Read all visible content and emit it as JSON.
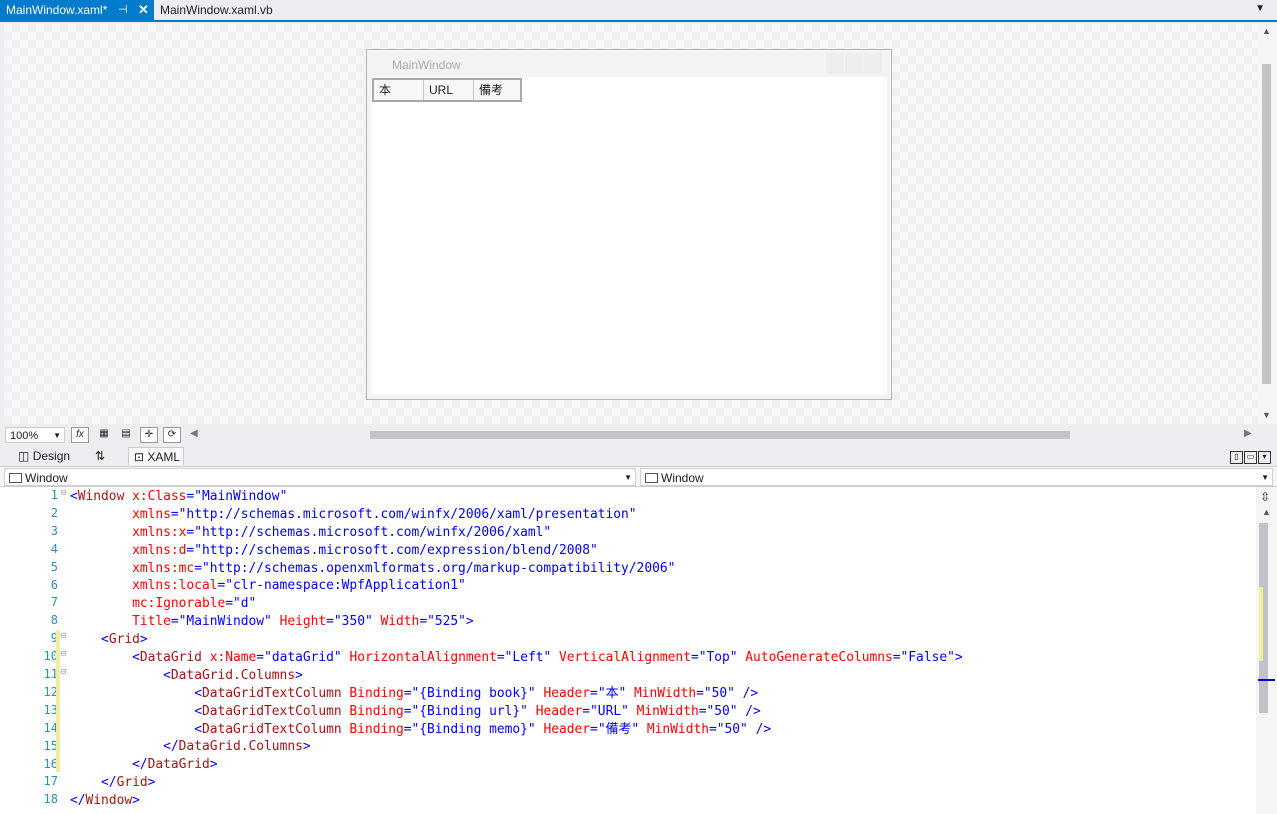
{
  "tabs": [
    {
      "label": "MainWindow.xaml*",
      "active": true
    },
    {
      "label": "MainWindow.xaml.vb",
      "active": false
    }
  ],
  "preview": {
    "window_title": "MainWindow",
    "columns": [
      "本",
      "URL",
      "備考"
    ]
  },
  "zoom": {
    "value": "100%"
  },
  "view_tabs": {
    "design": "Design",
    "xaml": "XAML",
    "swap_icon": "⇅"
  },
  "navigation": {
    "left": "Window",
    "right": "Window"
  },
  "editor": {
    "line_numbers": [
      "1",
      "2",
      "3",
      "4",
      "5",
      "6",
      "7",
      "8",
      "9",
      "10",
      "11",
      "12",
      "13",
      "14",
      "15",
      "16",
      "17",
      "18"
    ],
    "lines": [
      "<Window x:Class=\"MainWindow\"",
      "        xmlns=\"http://schemas.microsoft.com/winfx/2006/xaml/presentation\"",
      "        xmlns:x=\"http://schemas.microsoft.com/winfx/2006/xaml\"",
      "        xmlns:d=\"http://schemas.microsoft.com/expression/blend/2008\"",
      "        xmlns:mc=\"http://schemas.openxmlformats.org/markup-compatibility/2006\"",
      "        xmlns:local=\"clr-namespace:WpfApplication1\"",
      "        mc:Ignorable=\"d\"",
      "        Title=\"MainWindow\" Height=\"350\" Width=\"525\">",
      "    <Grid>",
      "        <DataGrid x:Name=\"dataGrid\" HorizontalAlignment=\"Left\" VerticalAlignment=\"Top\" AutoGenerateColumns=\"False\">",
      "            <DataGrid.Columns>",
      "                <DataGridTextColumn Binding=\"{Binding book}\" Header=\"本\" MinWidth=\"50\" />",
      "                <DataGridTextColumn Binding=\"{Binding url}\" Header=\"URL\" MinWidth=\"50\" />",
      "                <DataGridTextColumn Binding=\"{Binding memo}\" Header=\"備考\" MinWidth=\"50\" />",
      "            </DataGrid.Columns>",
      "        </DataGrid>",
      "    </Grid>",
      "</Window>"
    ]
  },
  "colors": {
    "accent": "#007acc",
    "element": "#a31515",
    "attribute": "#ff0000",
    "value": "#0000ff",
    "line_number": "#2b91af"
  }
}
